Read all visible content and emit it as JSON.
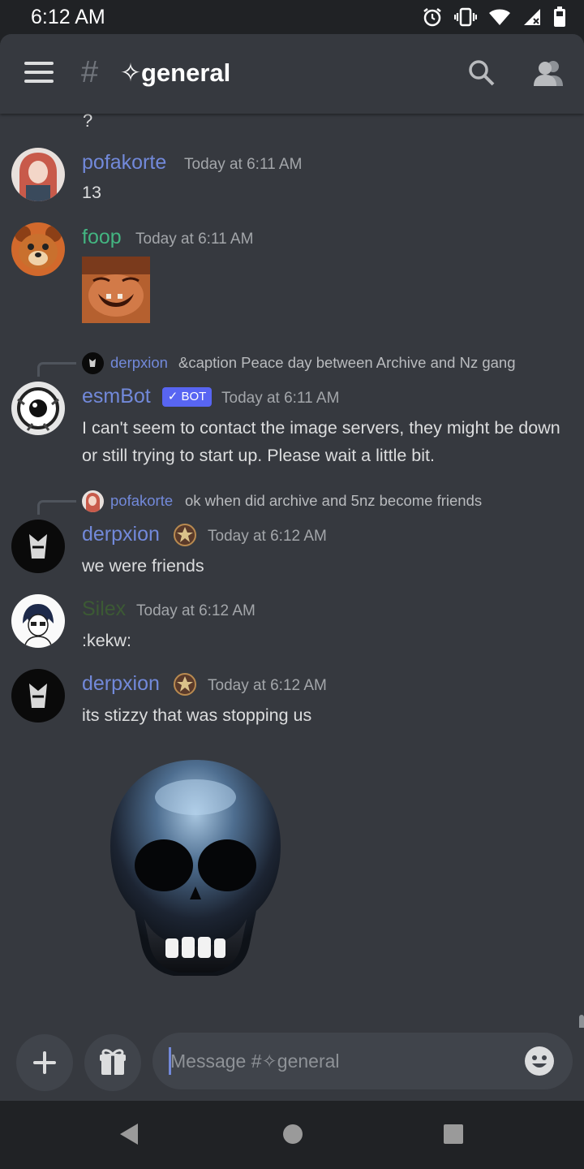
{
  "status": {
    "time": "6:12 AM",
    "icons": [
      "alarm-icon",
      "vibrate-icon",
      "wifi-icon",
      "signal-icon",
      "battery-icon"
    ]
  },
  "header": {
    "hash": "#",
    "channel": "✧general",
    "icons": [
      "menu-icon",
      "search-icon",
      "members-icon"
    ]
  },
  "messages": {
    "cut_text": "?",
    "m1": {
      "author": "pofakorte",
      "author_color": "#7289da",
      "time": "Today at 6:11 AM",
      "text": "13"
    },
    "m2": {
      "author": "foop",
      "author_color": "#43b581",
      "time": "Today at 6:11 AM",
      "attachment": "image"
    },
    "m3": {
      "reply_author": "derpxion",
      "reply_text": "&caption Peace day between Archive and Nz gang",
      "author": "esmBot",
      "author_color": "#7289da",
      "badge": "✓ BOT",
      "time": "Today at 6:11 AM",
      "text": "I can't seem to contact the image servers, they might be down or still trying to start up. Please wait a little bit."
    },
    "m4": {
      "reply_author": "pofakorte",
      "reply_text": "ok when did archive and 5nz become friends",
      "author": "derpxion",
      "author_color": "#7289da",
      "time": "Today at 6:12 AM",
      "text": "we were friends"
    },
    "m5": {
      "author": "Silex",
      "author_color": "#3c5a34",
      "time": "Today at 6:12 AM",
      "text": ":kekw:"
    },
    "m6": {
      "author": "derpxion",
      "author_color": "#7289da",
      "time": "Today at 6:12 AM",
      "text": "its stizzy that was stopping us",
      "sticker": "skull-sticker"
    }
  },
  "composer": {
    "placeholder": "Message #✧general",
    "icons": [
      "plus-icon",
      "gift-icon",
      "emoji-icon"
    ]
  },
  "nav": {
    "icons": [
      "back-icon",
      "home-icon",
      "recents-icon"
    ]
  },
  "colors": {
    "background": "#36393f",
    "header": "#36393f",
    "statusbar": "#202225",
    "input": "#40444b",
    "link": "#7289da",
    "bot_badge": "#5865f2"
  }
}
